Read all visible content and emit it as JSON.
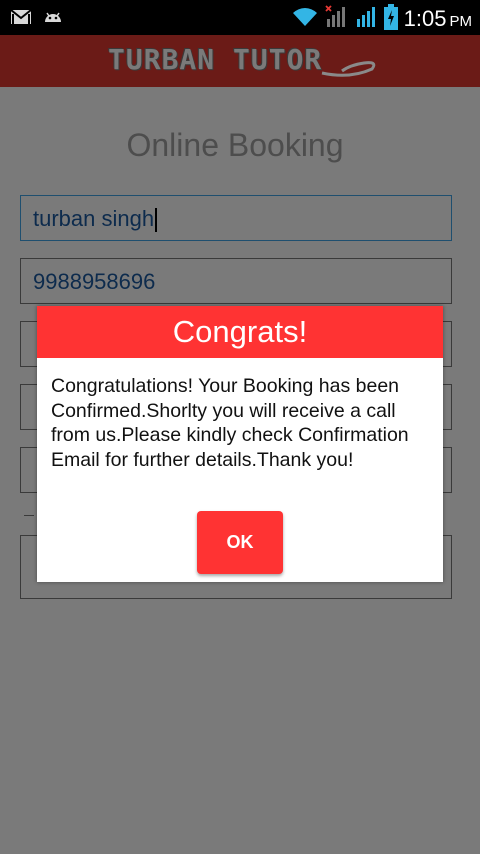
{
  "status_bar": {
    "time": "1:05",
    "ampm": "PM",
    "left_icons": [
      "gmail-icon",
      "android-debug-icon"
    ],
    "right_icons": [
      "wifi-icon",
      "signal-no-sim-icon",
      "signal-icon",
      "battery-charging-icon"
    ]
  },
  "app_bar": {
    "logo_text": "TURBAN TUTOR"
  },
  "form": {
    "title": "Online Booking",
    "name_value": "turban singh",
    "phone_value": "9988958696"
  },
  "dialog": {
    "title": "Congrats!",
    "message": "Congratulations! Your Booking has been Confirmed.Shorlty you will receive a call from us.Please kindly check Confirmation Email for further details.Thank you!",
    "ok_label": "OK"
  },
  "colors": {
    "dialog_accent": "#ff3333",
    "app_bar": "#6b1b17",
    "dim_overlay": "#7a7a7a"
  }
}
